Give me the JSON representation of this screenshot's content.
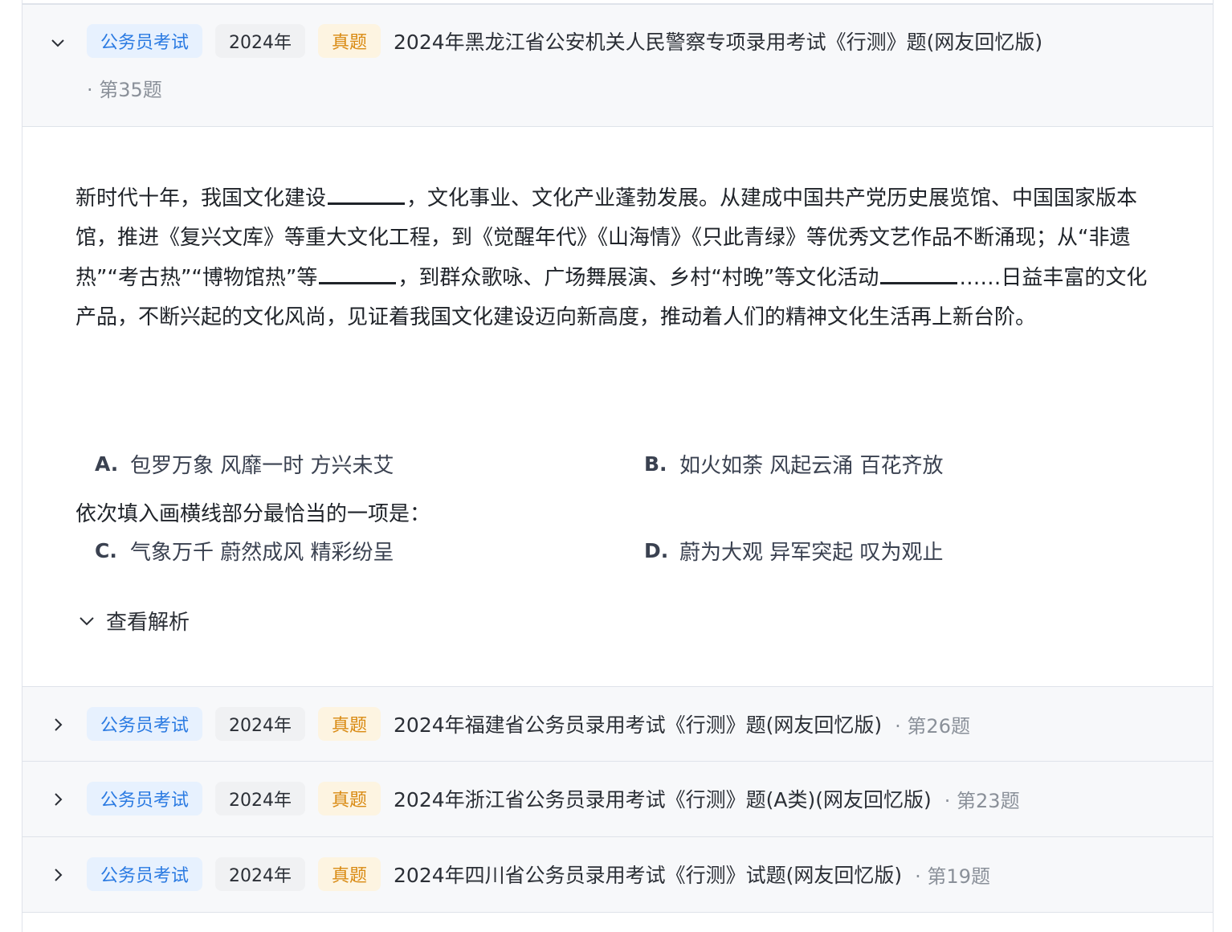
{
  "questions": [
    {
      "category": "公务员考试",
      "year": "2024年",
      "badge": "真题",
      "title": "2024年黑龙江省公安机关人民警察专项录用考试《行测》题(网友回忆版)",
      "number": "· 第35题",
      "expanded": true
    },
    {
      "category": "公务员考试",
      "year": "2024年",
      "badge": "真题",
      "title": "2024年福建省公务员录用考试《行测》题(网友回忆版)",
      "number": "· 第26题"
    },
    {
      "category": "公务员考试",
      "year": "2024年",
      "badge": "真题",
      "title": "2024年浙江省公务员录用考试《行测》题(A类)(网友回忆版)",
      "number": "· 第23题"
    },
    {
      "category": "公务员考试",
      "year": "2024年",
      "badge": "真题",
      "title": "2024年四川省公务员录用考试《行测》试题(网友回忆版)",
      "number": "· 第19题"
    }
  ],
  "passage": {
    "seg1": "新时代十年，我国文化建设",
    "seg2": "，文化事业、文化产业蓬勃发展。从建成中国共产党历史展览馆、中国国家版本馆，推进《复兴文库》等重大文化工程，到《觉醒年代》《山海情》《只此青绿》等优秀文艺作品不断涌现；从“非遗热”“考古热”“博物馆热”等",
    "seg3": "，到群众歌咏、广场舞展演、乡村“村晚”等文化活动",
    "seg4": "……日益丰富的文化产品，不断兴起的文化风尚，见证着我国文化建设迈向新高度，推动着人们的精神文化生活再上新台阶。"
  },
  "prompt": "依次填入画横线部分最恰当的一项是：",
  "options": [
    {
      "letter": "A.",
      "text": "包罗万象 风靡一时 方兴未艾"
    },
    {
      "letter": "B.",
      "text": "如火如荼 风起云涌 百花齐放"
    },
    {
      "letter": "C.",
      "text": "气象万千 蔚然成风 精彩纷呈"
    },
    {
      "letter": "D.",
      "text": "蔚为大观 异军突起 叹为观止"
    }
  ],
  "analysis_label": "查看解析",
  "colors": {
    "header_bg": "#f7f8fa",
    "category_tag": "#2a7ae2",
    "real_tag": "#d98a12",
    "border": "#dfe3ea"
  }
}
